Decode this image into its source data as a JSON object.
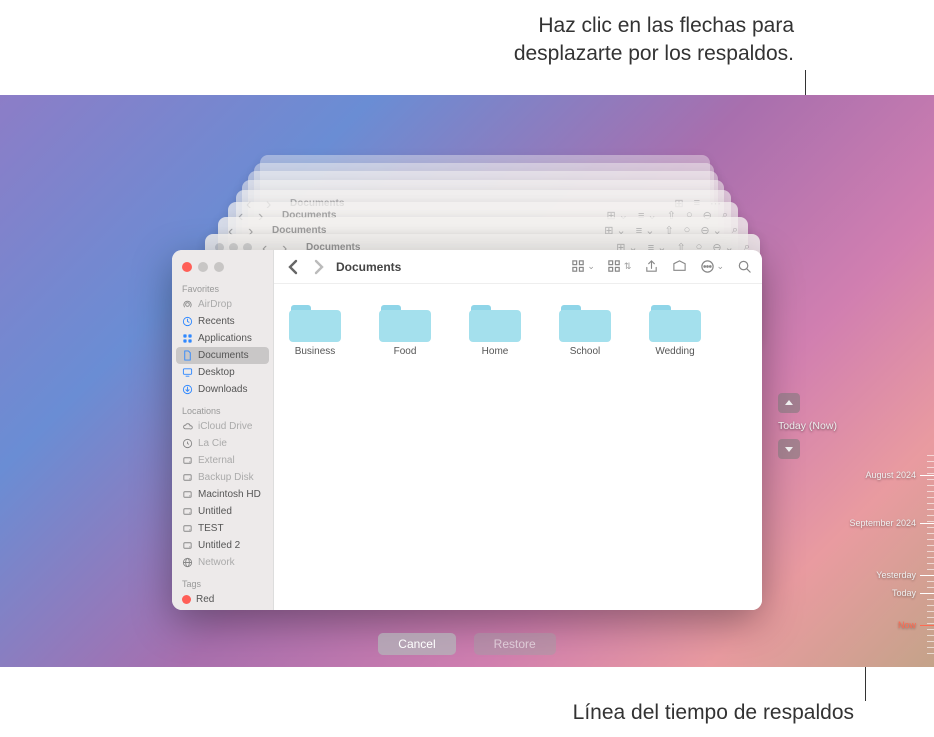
{
  "annotations": {
    "top": "Haz clic en las flechas para\ndesplazarte por los respaldos.",
    "bottom": "Línea del tiempo de respaldos"
  },
  "window": {
    "title": "Documents",
    "breadcrumb": "Documents"
  },
  "sidebar": {
    "favorites_header": "Favorites",
    "locations_header": "Locations",
    "tags_header": "Tags",
    "favorites": [
      {
        "label": "AirDrop",
        "icon": "airdrop",
        "dim": true
      },
      {
        "label": "Recents",
        "icon": "clock",
        "dim": false
      },
      {
        "label": "Applications",
        "icon": "apps",
        "dim": false
      },
      {
        "label": "Documents",
        "icon": "doc",
        "selected": true
      },
      {
        "label": "Desktop",
        "icon": "desktop",
        "dim": false
      },
      {
        "label": "Downloads",
        "icon": "download",
        "dim": false
      }
    ],
    "locations": [
      {
        "label": "iCloud Drive",
        "icon": "cloud",
        "dim": true
      },
      {
        "label": "La Cie",
        "icon": "timemachine",
        "dim": true
      },
      {
        "label": "External",
        "icon": "external",
        "dim": true
      },
      {
        "label": "Backup Disk",
        "icon": "external",
        "dim": true
      },
      {
        "label": "Macintosh HD",
        "icon": "hdd",
        "dim": false
      },
      {
        "label": "Untitled",
        "icon": "external",
        "dim": false
      },
      {
        "label": "TEST",
        "icon": "external",
        "dim": false
      },
      {
        "label": "Untitled 2",
        "icon": "external",
        "dim": false
      },
      {
        "label": "Network",
        "icon": "network",
        "dim": true
      }
    ],
    "tags": [
      {
        "label": "Red",
        "color": "#ff5e57"
      }
    ]
  },
  "folders": [
    {
      "name": "Business"
    },
    {
      "name": "Food"
    },
    {
      "name": "Home"
    },
    {
      "name": "School"
    },
    {
      "name": "Wedding"
    }
  ],
  "timemachine": {
    "current_label": "Today (Now)"
  },
  "timeline": {
    "labels": [
      {
        "text": "August 2024",
        "pos": 20
      },
      {
        "text": "September 2024",
        "pos": 68
      },
      {
        "text": "Yesterday",
        "pos": 120
      },
      {
        "text": "Today",
        "pos": 138
      },
      {
        "text": "Now",
        "pos": 170,
        "now": true
      }
    ]
  },
  "buttons": {
    "cancel": "Cancel",
    "restore": "Restore"
  }
}
